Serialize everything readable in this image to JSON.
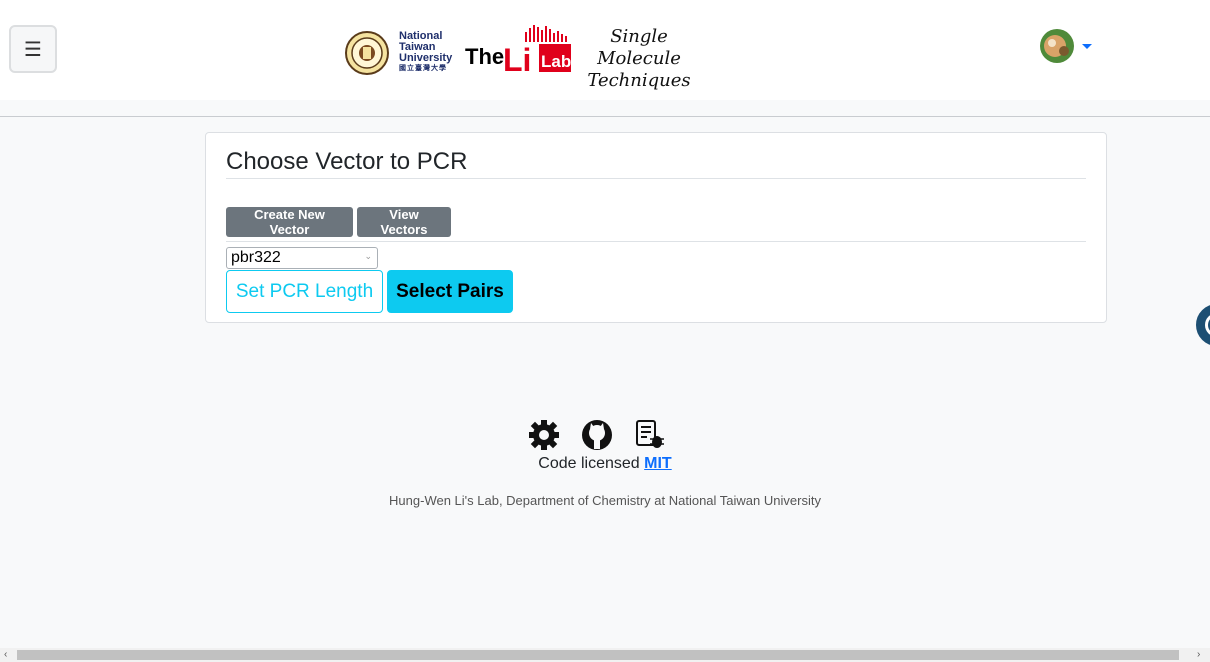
{
  "header": {
    "menu_glyph": "☰",
    "brand": {
      "ntu_line1": "National",
      "ntu_line2": "Taiwan",
      "ntu_line3": "University",
      "ntu_zh": "國立臺灣大學",
      "the": "The",
      "li": "Li",
      "lab": "Lab",
      "tagline1": "Single Molecule",
      "tagline2": "Techniques"
    },
    "avatar_icon": "user-avatar",
    "caret_icon": "caret-down-icon"
  },
  "card": {
    "title": "Choose Vector to PCR",
    "create_button": "Create New Vector",
    "view_button": "View Vectors",
    "vector_select_value": "pbr322",
    "set_length_button": "Set PCR Length",
    "select_pairs_button": "Select Pairs"
  },
  "footer": {
    "icons": [
      "gear-icon",
      "github-icon",
      "bug-report-icon"
    ],
    "license_prefix": "Code licensed",
    "license_link": "MIT",
    "credit": "Hung-Wen Li's Lab, Department of Chemistry at National Taiwan University"
  },
  "colors": {
    "info": "#0dcaf0",
    "secondary": "#6c757d",
    "link": "#0d6efd",
    "li_red": "#e0001b",
    "ntu_blue": "#1f2f6b"
  }
}
